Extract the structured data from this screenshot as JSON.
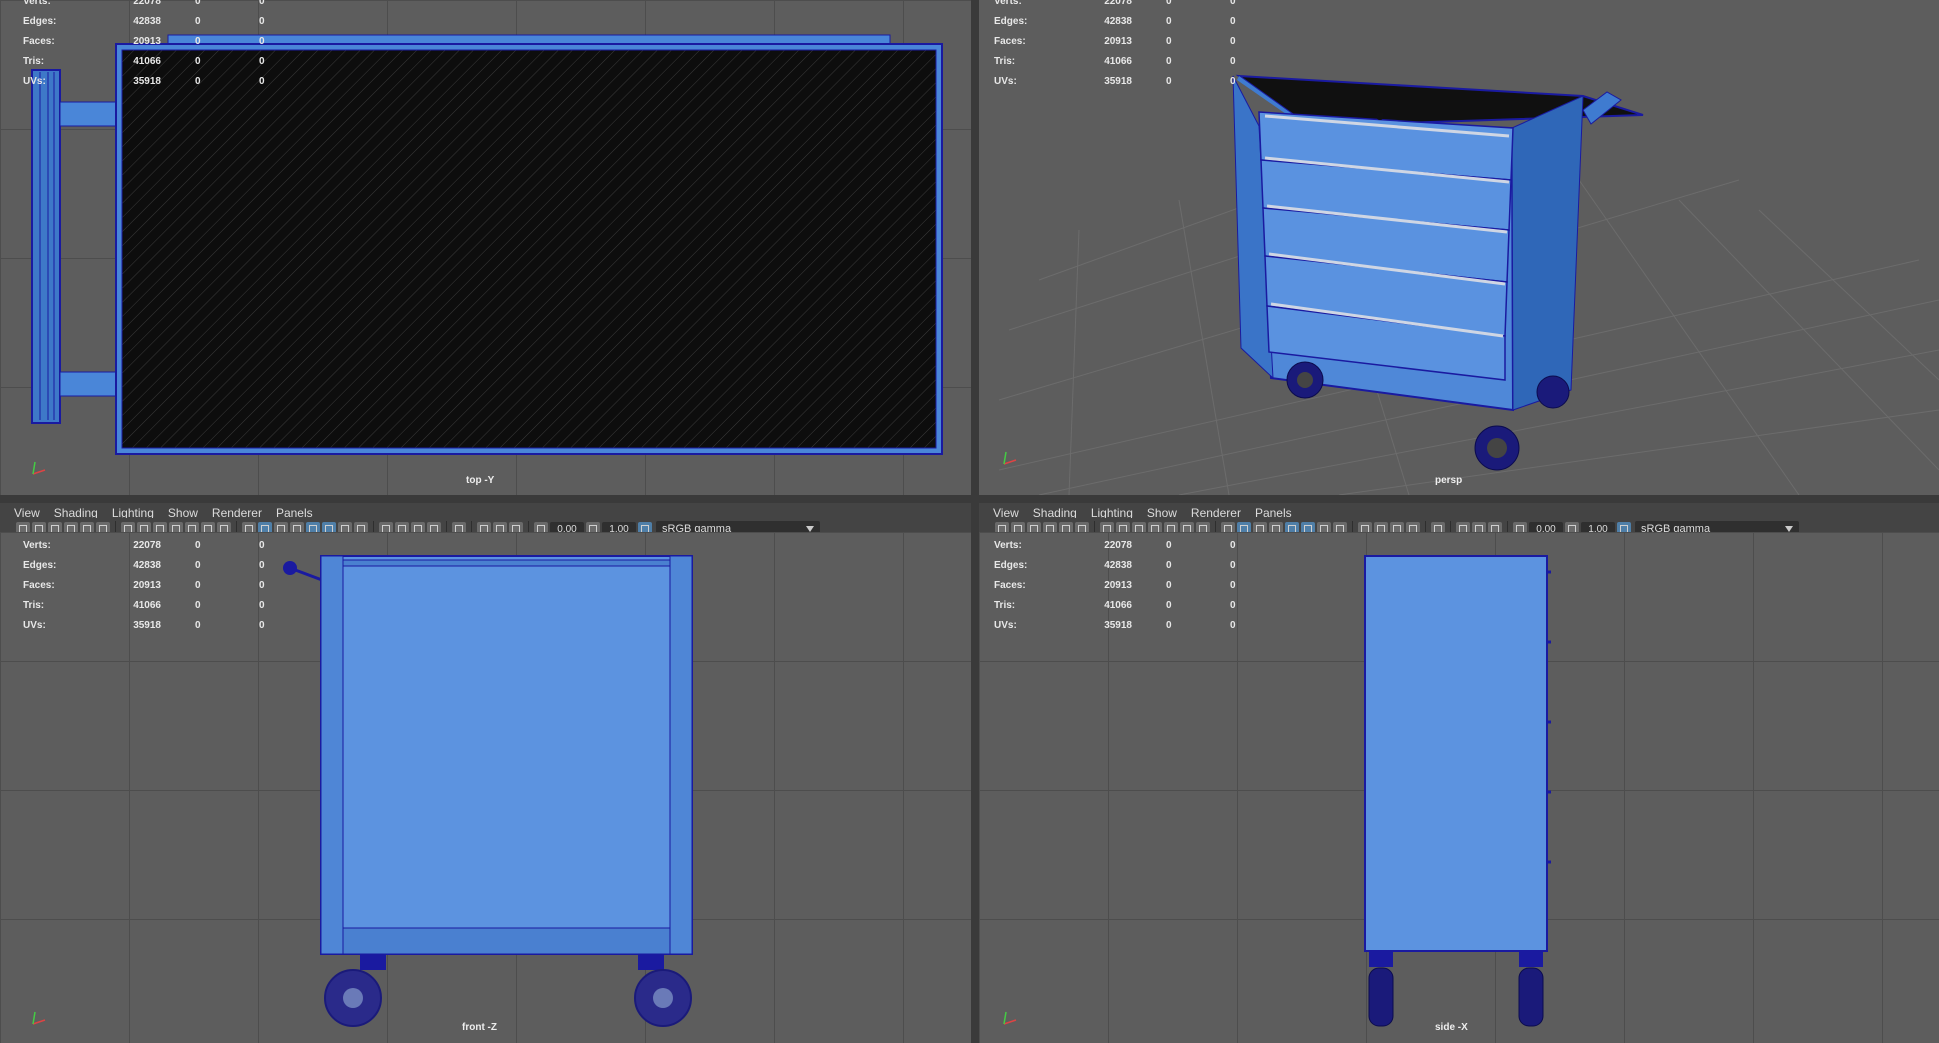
{
  "hud": {
    "labels": [
      "Verts:",
      "Edges:",
      "Faces:",
      "Tris:",
      "UVs:"
    ],
    "rows": [
      {
        "label": "Verts:",
        "value": "22078",
        "a": "0",
        "b": "0"
      },
      {
        "label": "Edges:",
        "value": "42838",
        "a": "0",
        "b": "0"
      },
      {
        "label": "Faces:",
        "value": "20913",
        "a": "0",
        "b": "0"
      },
      {
        "label": "Tris:",
        "value": "41066",
        "a": "0",
        "b": "0"
      },
      {
        "label": "UVs:",
        "value": "35918",
        "a": "0",
        "b": "0"
      }
    ]
  },
  "menu": [
    "View",
    "Shading",
    "Lighting",
    "Show",
    "Renderer",
    "Panels"
  ],
  "toolbar": {
    "exposure": "0.00",
    "gamma": "1.00",
    "color_space": "sRGB gamma"
  },
  "panes": {
    "top": {
      "camera": "top -Y"
    },
    "persp": {
      "camera": "persp"
    },
    "front": {
      "camera": "front -Z"
    },
    "side": {
      "camera": "side -X"
    }
  },
  "colors": {
    "viewport_bg": "#5d5d5d",
    "model_blue": "#4f86d6",
    "wire_blue": "#1a1aa0",
    "accent": "#4f7fa8"
  }
}
